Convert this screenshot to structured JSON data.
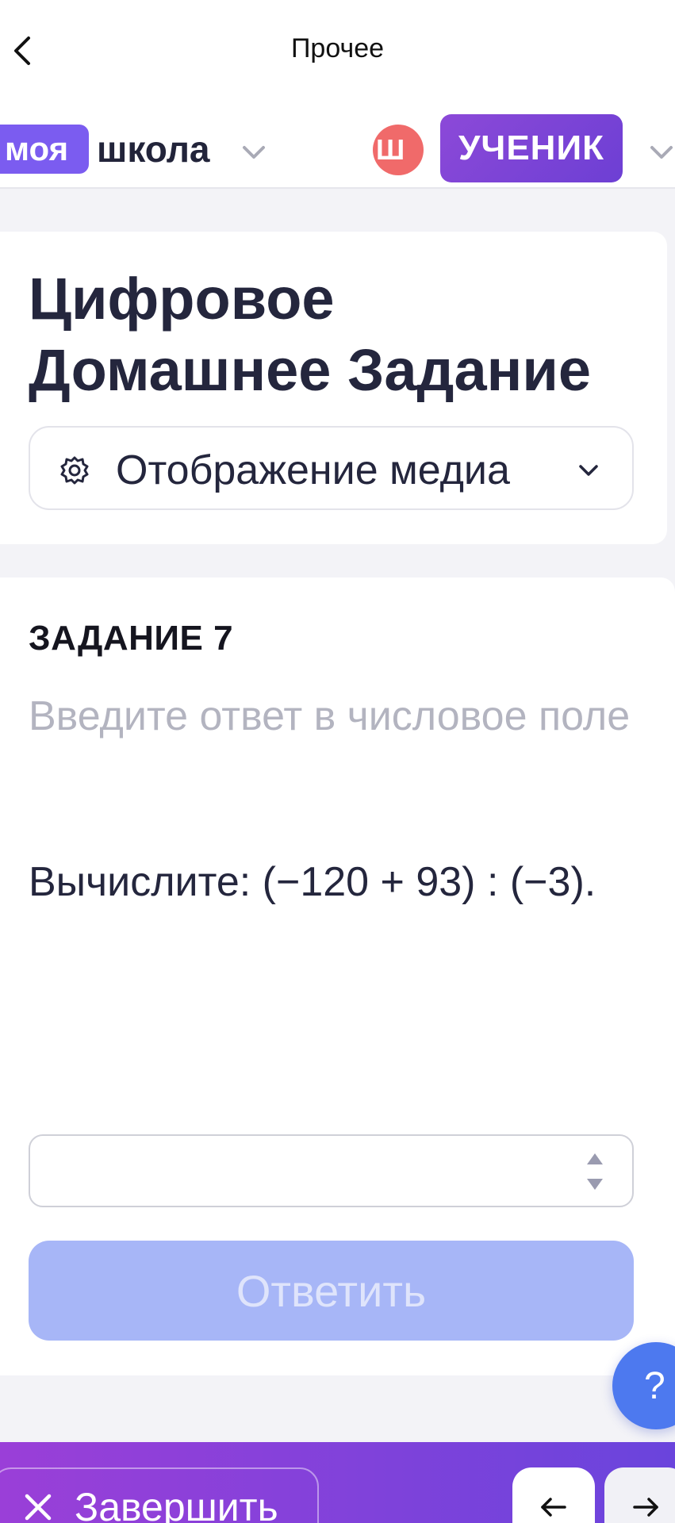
{
  "topbar": {
    "title": "Прочее",
    "back_icon": "chevron-left-icon"
  },
  "school_bar": {
    "logo_part1": "моя",
    "logo_part2": "школа",
    "avatar_text": "Ш",
    "role": "УЧЕНИК",
    "colors": {
      "logo_bg": "#7b5cf0",
      "role_bg": "#8c49d8",
      "avatar_bg": "#f06a6a"
    }
  },
  "header": {
    "title_line1": "Цифровое",
    "title_line2": "Домашнее Задание",
    "media_select_label": "Отображение медиа",
    "media_select_icon": "gear-icon"
  },
  "task": {
    "number_label": "ЗАДАНИЕ 7",
    "hint": "Введите ответ в числовое поле",
    "question": "Вычислите: (−120 + 93) : (−3).",
    "answer_value": "",
    "submit_label": "Ответить"
  },
  "help": {
    "label": "?"
  },
  "bottom_bar": {
    "finish_label": "Завершить",
    "prev_icon": "arrow-left-icon",
    "next_icon": "arrow-right-icon"
  },
  "colors": {
    "accent": "#4d79ef",
    "submit_disabled": "#a7b6f7",
    "text": "#24263d"
  }
}
